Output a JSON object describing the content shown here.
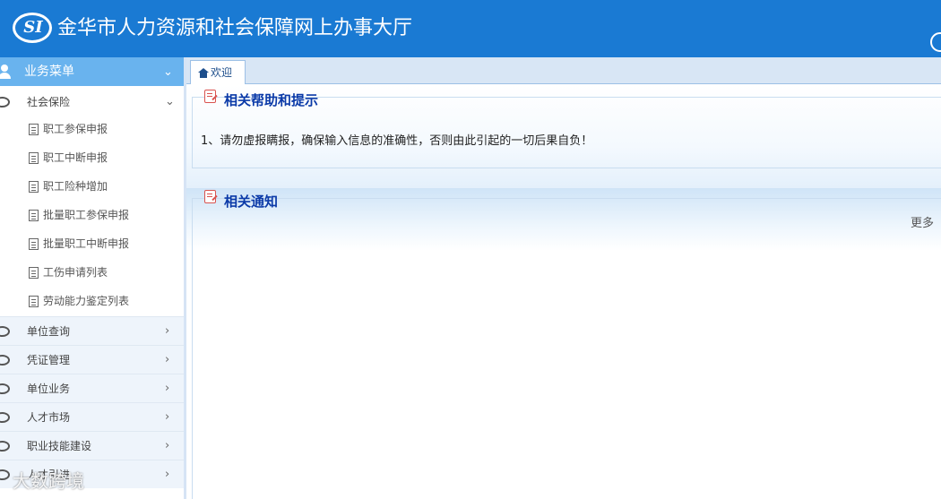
{
  "header": {
    "logo_text": "SI",
    "title": "金华市人力资源和社会保障网上办事大厅"
  },
  "sidebar": {
    "menu_title": "业务菜单",
    "expanded_group": {
      "label": "社会保险",
      "items": [
        {
          "label": "职工参保申报"
        },
        {
          "label": "职工中断申报"
        },
        {
          "label": "职工险种增加"
        },
        {
          "label": "批量职工参保申报"
        },
        {
          "label": "批量职工中断申报"
        },
        {
          "label": "工伤申请列表"
        },
        {
          "label": "劳动能力鉴定列表"
        }
      ]
    },
    "collapsed_groups": [
      {
        "label": "单位查询"
      },
      {
        "label": "凭证管理"
      },
      {
        "label": "单位业务"
      },
      {
        "label": "人才市场"
      },
      {
        "label": "职业技能建设"
      },
      {
        "label": "人才引进"
      }
    ]
  },
  "tabs": [
    {
      "label": "欢迎",
      "active": true
    }
  ],
  "content": {
    "help": {
      "title": "相关帮助和提示",
      "text": "1、请勿虚报瞒报，确保输入信息的准确性，否则由此引起的一切后果自负！"
    },
    "notice": {
      "title": "相关通知",
      "more_label": "更多"
    }
  },
  "watermark": "大数跨境",
  "colors": {
    "header_bg": "#1a7ad3",
    "menu_head_bg": "#69b3ee",
    "legend_title": "#0b3aa8"
  }
}
